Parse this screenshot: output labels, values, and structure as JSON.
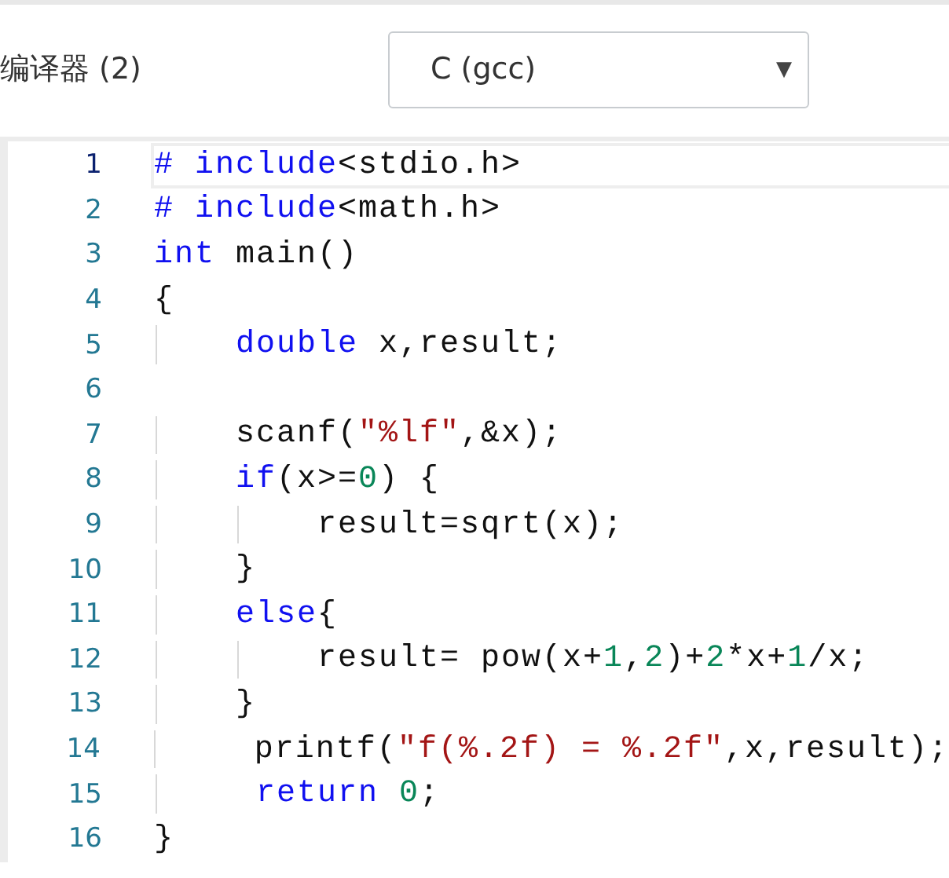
{
  "compiler": {
    "label": "编译器 (2)",
    "select": {
      "value": "C (gcc)",
      "arrow": "▼"
    }
  },
  "editor": {
    "lines": [
      {
        "number": "1",
        "selected": true,
        "tokens": [
          {
            "kind": "keyword",
            "text": "# include"
          },
          {
            "kind": "plain",
            "text": "<stdio.h>"
          }
        ]
      },
      {
        "number": "2",
        "selected": false,
        "tokens": [
          {
            "kind": "keyword",
            "text": "# include"
          },
          {
            "kind": "plain",
            "text": "<math.h>"
          }
        ]
      },
      {
        "number": "3",
        "selected": false,
        "tokens": [
          {
            "kind": "keyword",
            "text": "int"
          },
          {
            "kind": "plain",
            "text": " main()"
          }
        ]
      },
      {
        "number": "4",
        "selected": false,
        "tokens": [
          {
            "kind": "plain",
            "text": "{"
          }
        ]
      },
      {
        "number": "5",
        "selected": false,
        "tokens": [
          {
            "kind": "keyword",
            "text": "    double"
          },
          {
            "kind": "plain",
            "text": " x,result;"
          }
        ]
      },
      {
        "number": "6",
        "selected": false
      },
      {
        "number": "7",
        "selected": false,
        "tokens": [
          {
            "kind": "plain",
            "text": "    scanf("
          },
          {
            "kind": "string",
            "text": "\"%lf\""
          },
          {
            "kind": "plain",
            "text": ",&x);"
          }
        ]
      },
      {
        "number": "8",
        "selected": false,
        "tokens": [
          {
            "kind": "keyword",
            "text": "    if"
          },
          {
            "kind": "plain",
            "text": "(x>="
          },
          {
            "kind": "number",
            "text": "0"
          },
          {
            "kind": "plain",
            "text": ") {"
          }
        ]
      },
      {
        "number": "9",
        "selected": false,
        "tokens": [
          {
            "kind": "plain",
            "text": "        result=sqrt(x);"
          }
        ]
      },
      {
        "number": "10",
        "selected": false,
        "tokens": [
          {
            "kind": "plain",
            "text": "    }"
          }
        ]
      },
      {
        "number": "11",
        "selected": false,
        "tokens": [
          {
            "kind": "keyword",
            "text": "    else"
          },
          {
            "kind": "plain",
            "text": "{"
          }
        ]
      },
      {
        "number": "12",
        "selected": false,
        "tokens": [
          {
            "kind": "plain",
            "text": "        result= pow(x+"
          },
          {
            "kind": "number",
            "text": "1"
          },
          {
            "kind": "plain",
            "text": ","
          },
          {
            "kind": "number",
            "text": "2"
          },
          {
            "kind": "plain",
            "text": ")+"
          },
          {
            "kind": "number",
            "text": "2"
          },
          {
            "kind": "plain",
            "text": "*x+"
          },
          {
            "kind": "number",
            "text": "1"
          },
          {
            "kind": "plain",
            "text": "/x;"
          }
        ]
      },
      {
        "number": "13",
        "selected": false,
        "tokens": [
          {
            "kind": "plain",
            "text": "    }"
          }
        ]
      },
      {
        "number": "14",
        "selected": false,
        "tokens": [
          {
            "kind": "plain",
            "text": "     printf("
          },
          {
            "kind": "string",
            "text": "\"f(%.2f) = %.2f\""
          },
          {
            "kind": "plain",
            "text": ",x,result);"
          }
        ]
      },
      {
        "number": "15",
        "selected": false,
        "tokens": [
          {
            "kind": "keyword",
            "text": "     return "
          },
          {
            "kind": "number",
            "text": "0"
          },
          {
            "kind": "plain",
            "text": ";"
          }
        ]
      },
      {
        "number": "16",
        "selected": false,
        "tokens": [
          {
            "kind": "plain",
            "text": "}"
          }
        ]
      }
    ]
  }
}
